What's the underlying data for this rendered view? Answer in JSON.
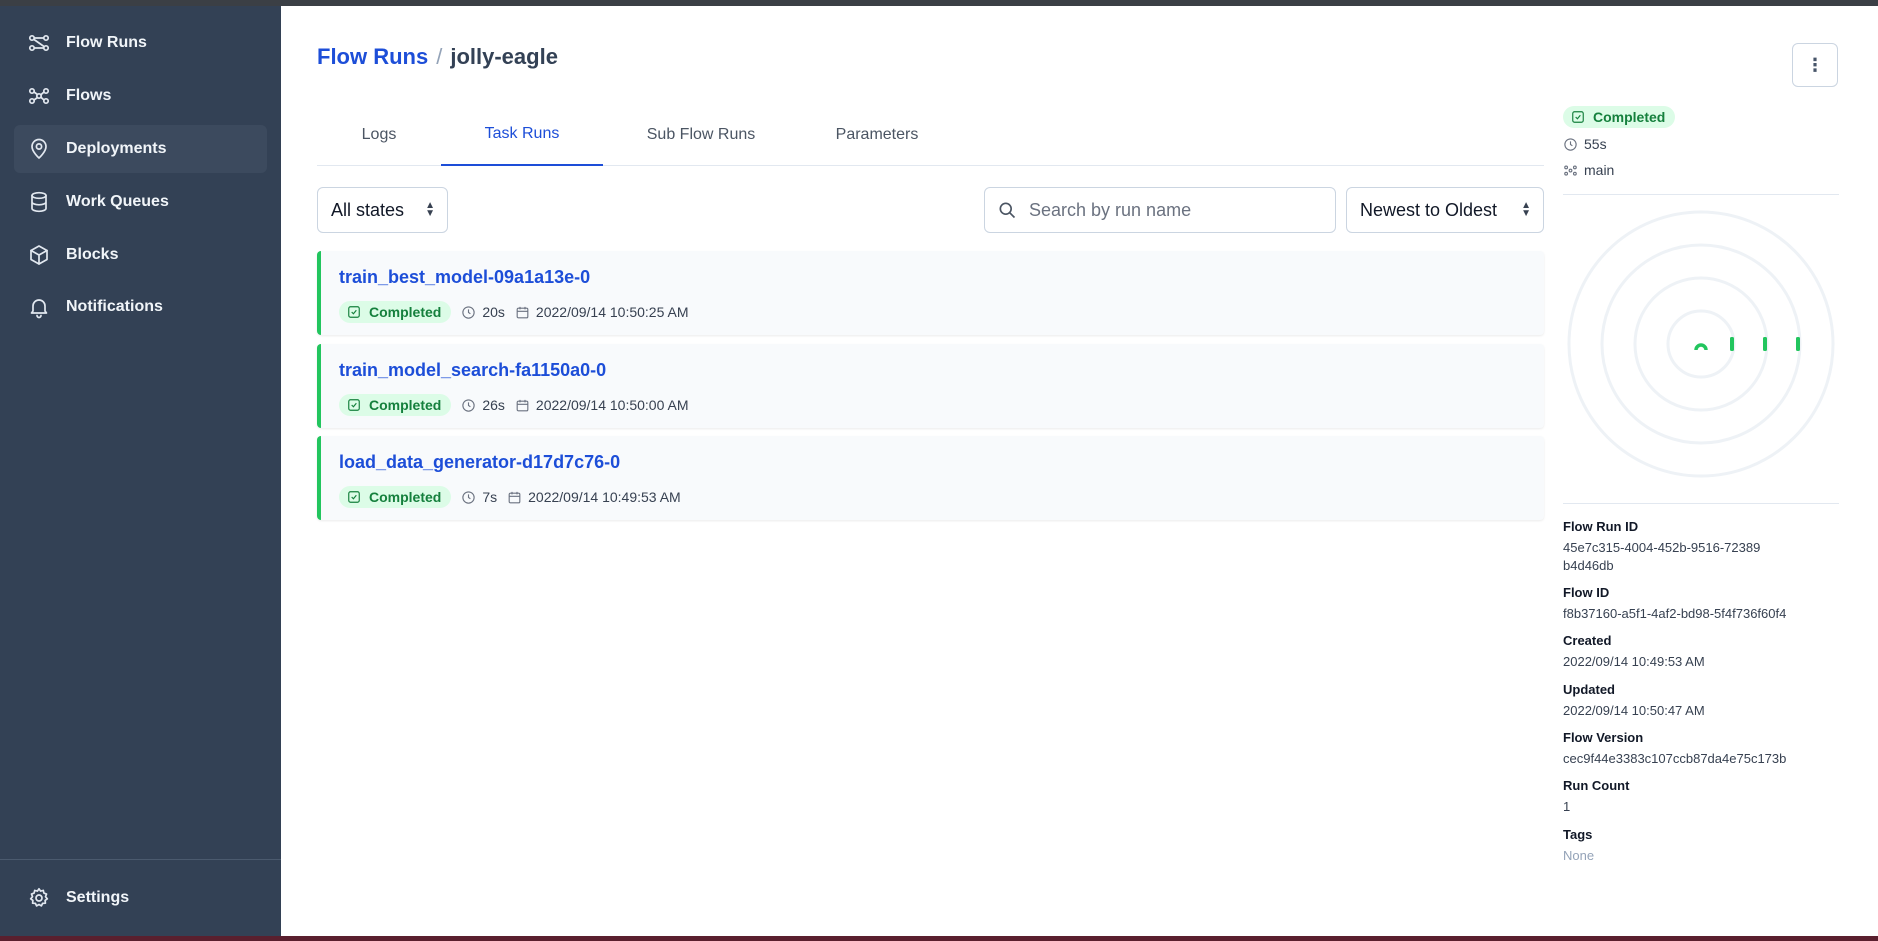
{
  "sidebar": {
    "items": [
      {
        "label": "Flow Runs",
        "icon": "flow-runs-icon"
      },
      {
        "label": "Flows",
        "icon": "flows-icon"
      },
      {
        "label": "Deployments",
        "icon": "map-pin-icon"
      },
      {
        "label": "Work Queues",
        "icon": "database-icon"
      },
      {
        "label": "Blocks",
        "icon": "cube-icon"
      },
      {
        "label": "Notifications",
        "icon": "bell-icon"
      }
    ],
    "settings_label": "Settings",
    "active_index": 2
  },
  "header": {
    "breadcrumb_root": "Flow Runs",
    "breadcrumb_sep": "/",
    "breadcrumb_current": "jolly-eagle",
    "menu_glyph": "⋮"
  },
  "tabs": [
    {
      "label": "Logs"
    },
    {
      "label": "Task Runs"
    },
    {
      "label": "Sub Flow Runs"
    },
    {
      "label": "Parameters"
    }
  ],
  "active_tab": "Task Runs",
  "filters": {
    "state_value": "All states",
    "search_placeholder": "Search by run name",
    "sort_value": "Newest to Oldest"
  },
  "task_runs": [
    {
      "name": "train_best_model-09a1a13e-0",
      "state": "Completed",
      "duration": "20s",
      "start": "2022/09/14 10:50:25 AM"
    },
    {
      "name": "train_model_search-fa1150a0-0",
      "state": "Completed",
      "duration": "26s",
      "start": "2022/09/14 10:50:00 AM"
    },
    {
      "name": "load_data_generator-d17d7c76-0",
      "state": "Completed",
      "duration": "7s",
      "start": "2022/09/14 10:49:53 AM"
    }
  ],
  "details": {
    "state": "Completed",
    "duration": "55s",
    "flow_name": "main",
    "flow_run_id_label": "Flow Run ID",
    "flow_run_id": "45e7c315-4004-452b-9516-72389b4d46db",
    "flow_id_label": "Flow ID",
    "flow_id": "f8b37160-a5f1-4af2-bd98-5f4f736f60f4",
    "created_label": "Created",
    "created": "2022/09/14 10:49:53 AM",
    "updated_label": "Updated",
    "updated": "2022/09/14 10:50:47 AM",
    "flow_version_label": "Flow Version",
    "flow_version": "cec9f44e3383c107ccb87da4e75c173b",
    "run_count_label": "Run Count",
    "run_count": "1",
    "tags_label": "Tags",
    "tags": "None"
  },
  "colors": {
    "sidebar_bg": "#334155",
    "accent": "#1d4ed8",
    "completed": "#22c55e",
    "completed_text": "#15803d"
  }
}
